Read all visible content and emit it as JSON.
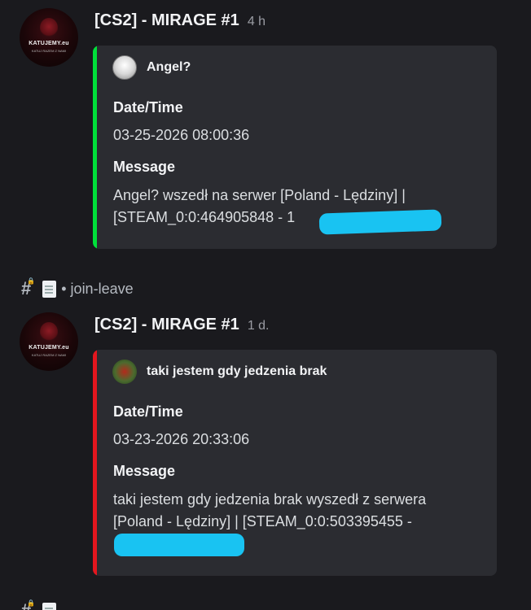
{
  "messages": [
    {
      "author": "[CS2] - MIRAGE #1",
      "timestamp": "4 h",
      "avatar_text": "KATUJEMY.eu",
      "avatar_sub": "KATUJ RAZEM Z NAMI",
      "embed": {
        "accent": "#00e03a",
        "author_name": "Angel?",
        "field1_name": "Date/Time",
        "field1_value": "03-25-2026 08:00:36",
        "field2_name": "Message",
        "field2_value": "Angel? wszedł na serwer [Poland - Lędziny] | [STEAM_0:0:464905848 - 1"
      }
    },
    {
      "author": "[CS2] - MIRAGE #1",
      "timestamp": "1 d.",
      "avatar_text": "KATUJEMY.eu",
      "avatar_sub": "KATUJ RAZEM Z NAMI",
      "embed": {
        "accent": "#e3161e",
        "author_name": "taki jestem gdy jedzenia brak",
        "field1_name": "Date/Time",
        "field1_value": "03-23-2026 20:33:06",
        "field2_name": "Message",
        "field2_value": "taki jestem gdy jedzenia brak wyszedł z serwera [Poland - Lędziny] | [STEAM_0:0:503395455 -"
      }
    }
  ],
  "channel": {
    "icon": "hash-lock-icon",
    "doc_icon": "document-icon",
    "name": "• join-leave"
  }
}
